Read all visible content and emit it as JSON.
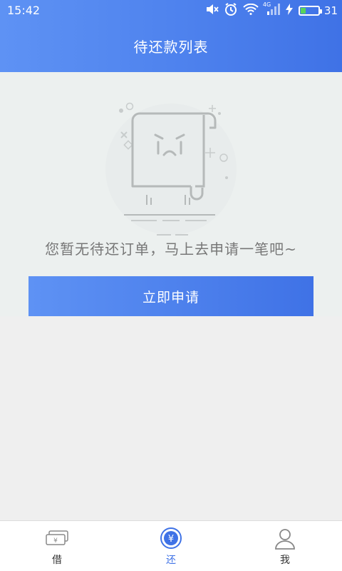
{
  "status_bar": {
    "time": "15:42",
    "network": "4G",
    "battery_level": 31,
    "battery_text": "31"
  },
  "header": {
    "title": "待还款列表"
  },
  "empty_state": {
    "message": "您暂无待还订单，马上去申请一笔吧~",
    "button_label": "立即申请"
  },
  "bottom_nav": {
    "items": [
      {
        "label": "借",
        "icon": "money-bill-icon",
        "active": false
      },
      {
        "label": "还",
        "icon": "yen-circle-icon",
        "active": true
      },
      {
        "label": "我",
        "icon": "user-icon",
        "active": false
      }
    ]
  },
  "colors": {
    "primary": "#4f83ee",
    "background": "#efefef",
    "content_bg": "#ecf0ef",
    "nav_active": "#3f72e6"
  }
}
